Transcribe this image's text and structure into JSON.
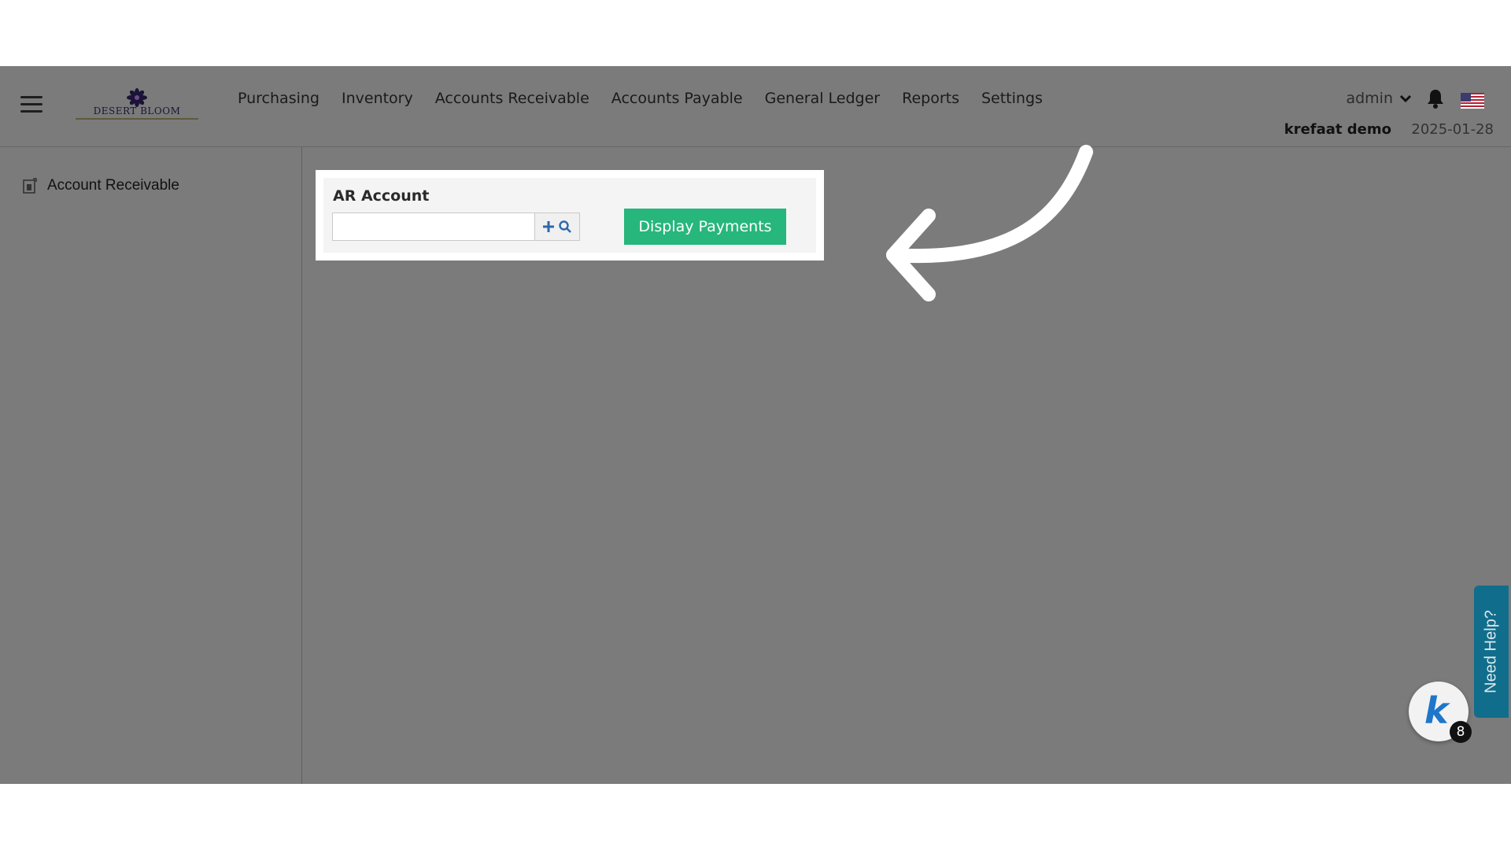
{
  "header": {
    "logo_text": "DESERT BLOOM",
    "nav": [
      "Purchasing",
      "Inventory",
      "Accounts Receivable",
      "Accounts Payable",
      "General Ledger",
      "Reports",
      "Settings"
    ],
    "user": "admin",
    "company": "krefaat demo",
    "date": "2025-01-28"
  },
  "sidebar": {
    "items": [
      {
        "label": "Account Receivable"
      }
    ]
  },
  "form": {
    "field_label": "AR Account",
    "field_value": "",
    "display_button": "Display Payments"
  },
  "help": {
    "label": "Need Help?",
    "widget_letter": "k",
    "badge_count": "8"
  },
  "colors": {
    "overlay": "#7b7b7b",
    "button": "#27b67b",
    "help_tab": "#106e8c",
    "widget_k": "#1d76c9"
  }
}
